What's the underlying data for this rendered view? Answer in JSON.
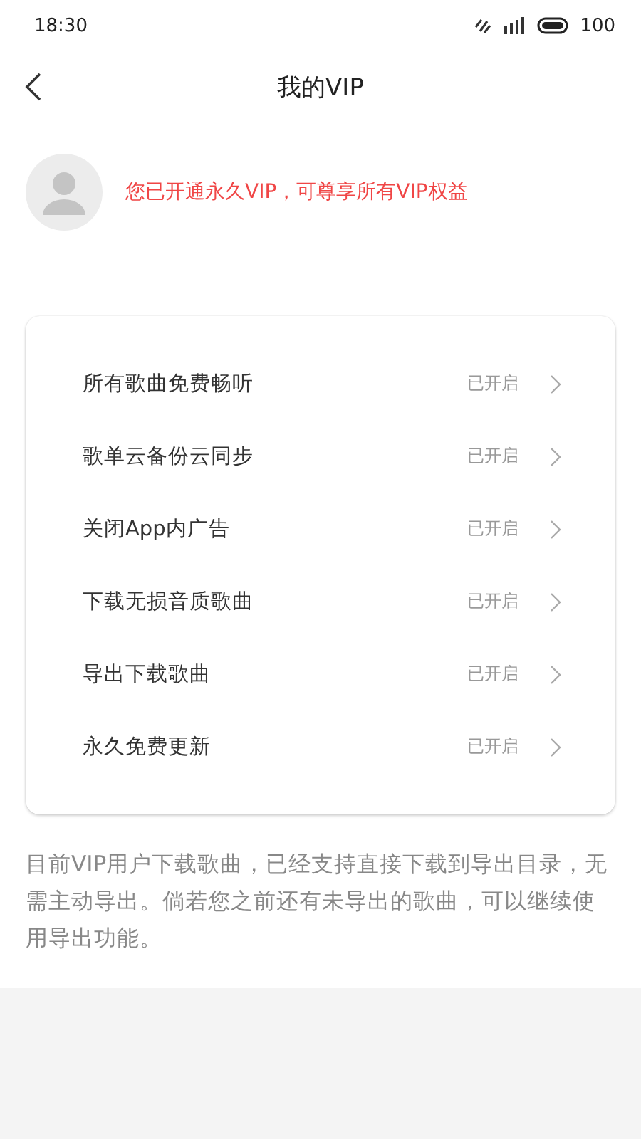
{
  "status_bar": {
    "time": "18:30",
    "battery": "100"
  },
  "header": {
    "title": "我的VIP"
  },
  "profile": {
    "message": "您已开通永久VIP，可尊享所有VIP权益"
  },
  "benefits": [
    {
      "label": "所有歌曲免费畅听",
      "status": "已开启"
    },
    {
      "label": "歌单云备份云同步",
      "status": "已开启"
    },
    {
      "label": "关闭App内广告",
      "status": "已开启"
    },
    {
      "label": "下载无损音质歌曲",
      "status": "已开启"
    },
    {
      "label": "导出下载歌曲",
      "status": "已开启"
    },
    {
      "label": "永久免费更新",
      "status": "已开启"
    }
  ],
  "note": "目前VIP用户下载歌曲，已经支持直接下载到导出目录，无需主动导出。倘若您之前还有未导出的歌曲，可以继续使用导出功能。"
}
